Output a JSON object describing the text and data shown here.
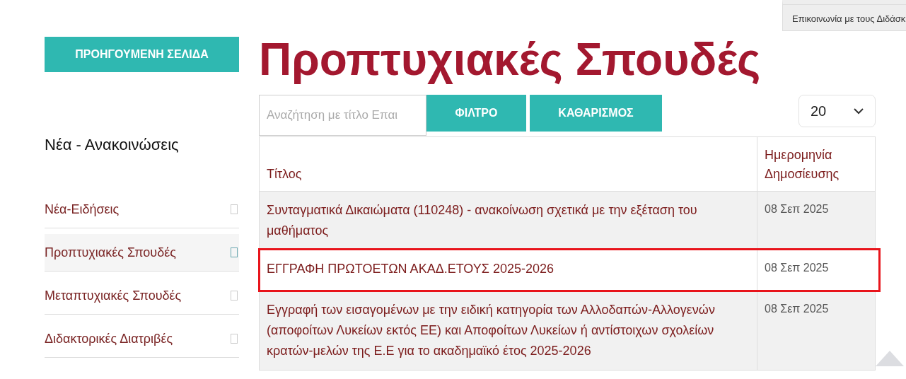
{
  "top_menu": {
    "item": "Επικοινωνία με τους Διδάσκ"
  },
  "back_button": "ΠΡΟΗΓΟΥΜΕΝΗ ΣΕΛΙΔΑ",
  "page_title": "Προπτυχιακές Σπουδές",
  "sidebar": {
    "heading": "Νέα - Ανακοινώσεις",
    "items": [
      {
        "label": "Νέα-Ειδήσεις",
        "selected": false
      },
      {
        "label": "Προπτυχιακές Σπουδές",
        "selected": true
      },
      {
        "label": "Μεταπτυχιακές Σπουδές",
        "selected": false
      },
      {
        "label": "Διδακτορικές Διατριβές",
        "selected": false
      }
    ]
  },
  "filter": {
    "search": {
      "placeholder": "Αναζήτηση με τίτλο Επαι"
    },
    "buttons": [
      "ΦΙΛΤΡΟ",
      "ΚΑΘΑΡΙΣΜΟΣ"
    ],
    "page_size": "20"
  },
  "table": {
    "columns": [
      "Τίτλος",
      "Ημερομηνία Δημοσίευσης"
    ],
    "rows": [
      {
        "title": "Συνταγματικά Δικαιώματα (110248) - ανακοίνωση σχετικά με την εξέταση του μαθήματος",
        "date": "08 Σεπ 2025",
        "highlighted": false
      },
      {
        "title": "ΕΓΓΡΑΦΗ ΠΡΩΤΟΕΤΩΝ ΑΚΑΔ.ΕΤΟΥΣ 2025-2026",
        "date": "08 Σεπ 2025",
        "highlighted": true
      },
      {
        "title": "Εγγραφή των εισαγομένων με την ειδική κατηγορία των Αλλοδαπών-Αλλογενών (αποφοίτων Λυκείων εκτός ΕΕ) και Αποφοίτων Λυκείων ή αντίστοιχων σχολείων κρατών-μελών της Ε.Ε για το ακαδημαϊκό έτος 2025-2026",
        "date": "08 Σεπ 2025",
        "highlighted": false
      }
    ]
  }
}
